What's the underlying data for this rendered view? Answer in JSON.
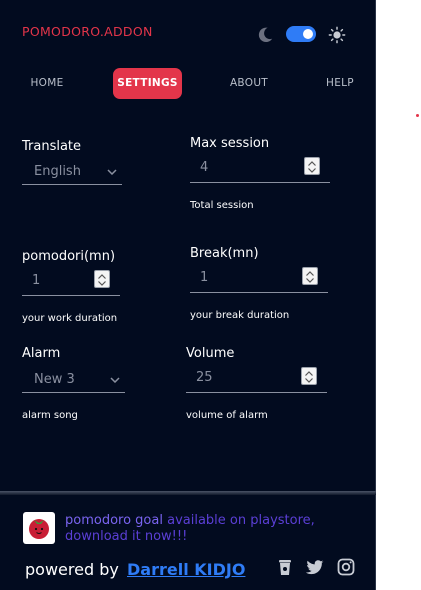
{
  "app": {
    "title": "POMODORO.ADDON"
  },
  "theme": {
    "dark_mode_on": true
  },
  "tabs": [
    {
      "label": "HOME",
      "active": false
    },
    {
      "label": "SETTINGS",
      "active": true
    },
    {
      "label": "ABOUT",
      "active": false
    },
    {
      "label": "HELP",
      "active": false
    }
  ],
  "settings": {
    "translate": {
      "label": "Translate",
      "value": "English"
    },
    "max_session": {
      "label": "Max session",
      "value": "4",
      "hint": "Total session"
    },
    "pomodori": {
      "label": "pomodori(mn)",
      "value": "1",
      "hint": "your work duration"
    },
    "break": {
      "label": "Break(mn)",
      "value": "1",
      "hint": "your break duration"
    },
    "alarm": {
      "label": "Alarm",
      "value": "New 3",
      "hint": "alarm song"
    },
    "volume": {
      "label": "Volume",
      "value": "25",
      "hint": "volume of alarm"
    }
  },
  "footer": {
    "promo_goal": "pomodoro goal",
    "promo_rest": " available on playstore, download it now!!!",
    "powered_by": "powered by",
    "author": "Darrell KIDJO",
    "social_icons": [
      "coffee-cup-icon",
      "twitter-icon",
      "instagram-icon"
    ]
  },
  "colors": {
    "background": "#020b1f",
    "accent": "#e3354a",
    "toggle": "#2f7cf6",
    "link": "#2f7cf6",
    "promo": "#5b3fd6"
  }
}
